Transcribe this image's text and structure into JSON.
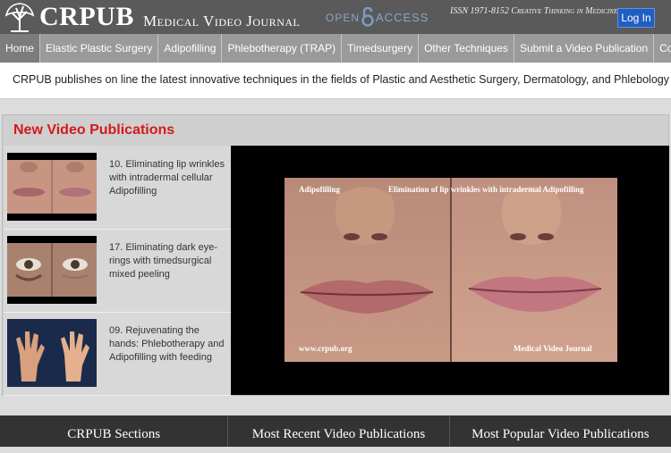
{
  "header": {
    "logo_main": "CRPUB",
    "logo_sub": "Medical Video Journal",
    "open_access_left": "OPEN",
    "open_access_right": "ACCESS",
    "issn": "ISSN 1971-8152 Creative Thinking in Medicine",
    "login_label": "Log In"
  },
  "nav": {
    "items": [
      {
        "label": "Home",
        "active": true
      },
      {
        "label": "Elastic Plastic Surgery"
      },
      {
        "label": "Adipofilling"
      },
      {
        "label": "Phlebotherapy (TRAP)"
      },
      {
        "label": "Timedsurgery"
      },
      {
        "label": "Other Techniques"
      },
      {
        "label": "Submit a Video Publication"
      },
      {
        "label": "Contact"
      }
    ]
  },
  "banner": {
    "text": "CRPUB publishes on line the latest innovative techniques in the fields of Plastic and Aesthetic Surgery, Dermatology, and Phlebology"
  },
  "section": {
    "title": "New Video Publications",
    "items": [
      {
        "caption": "10. Eliminating lip wrinkles with intradermal cellular Adipofilling"
      },
      {
        "caption": "17. Eliminating dark eye-rings with timedsurgical mixed peeling"
      },
      {
        "caption": "09. Rejuvenating the hands: Phlebotherapy and Adipofilling with feeding"
      }
    ],
    "video": {
      "label_left": "Adipofilling",
      "label_title": "Elimination of lip wrinkles with intradermal Adipofilling",
      "label_url": "www.crpub.org",
      "label_journal": "Medical Video Journal"
    }
  },
  "footer": {
    "sections": [
      "CRPUB Sections",
      "Most Recent Video Publications",
      "Most Popular Video Publications"
    ]
  }
}
